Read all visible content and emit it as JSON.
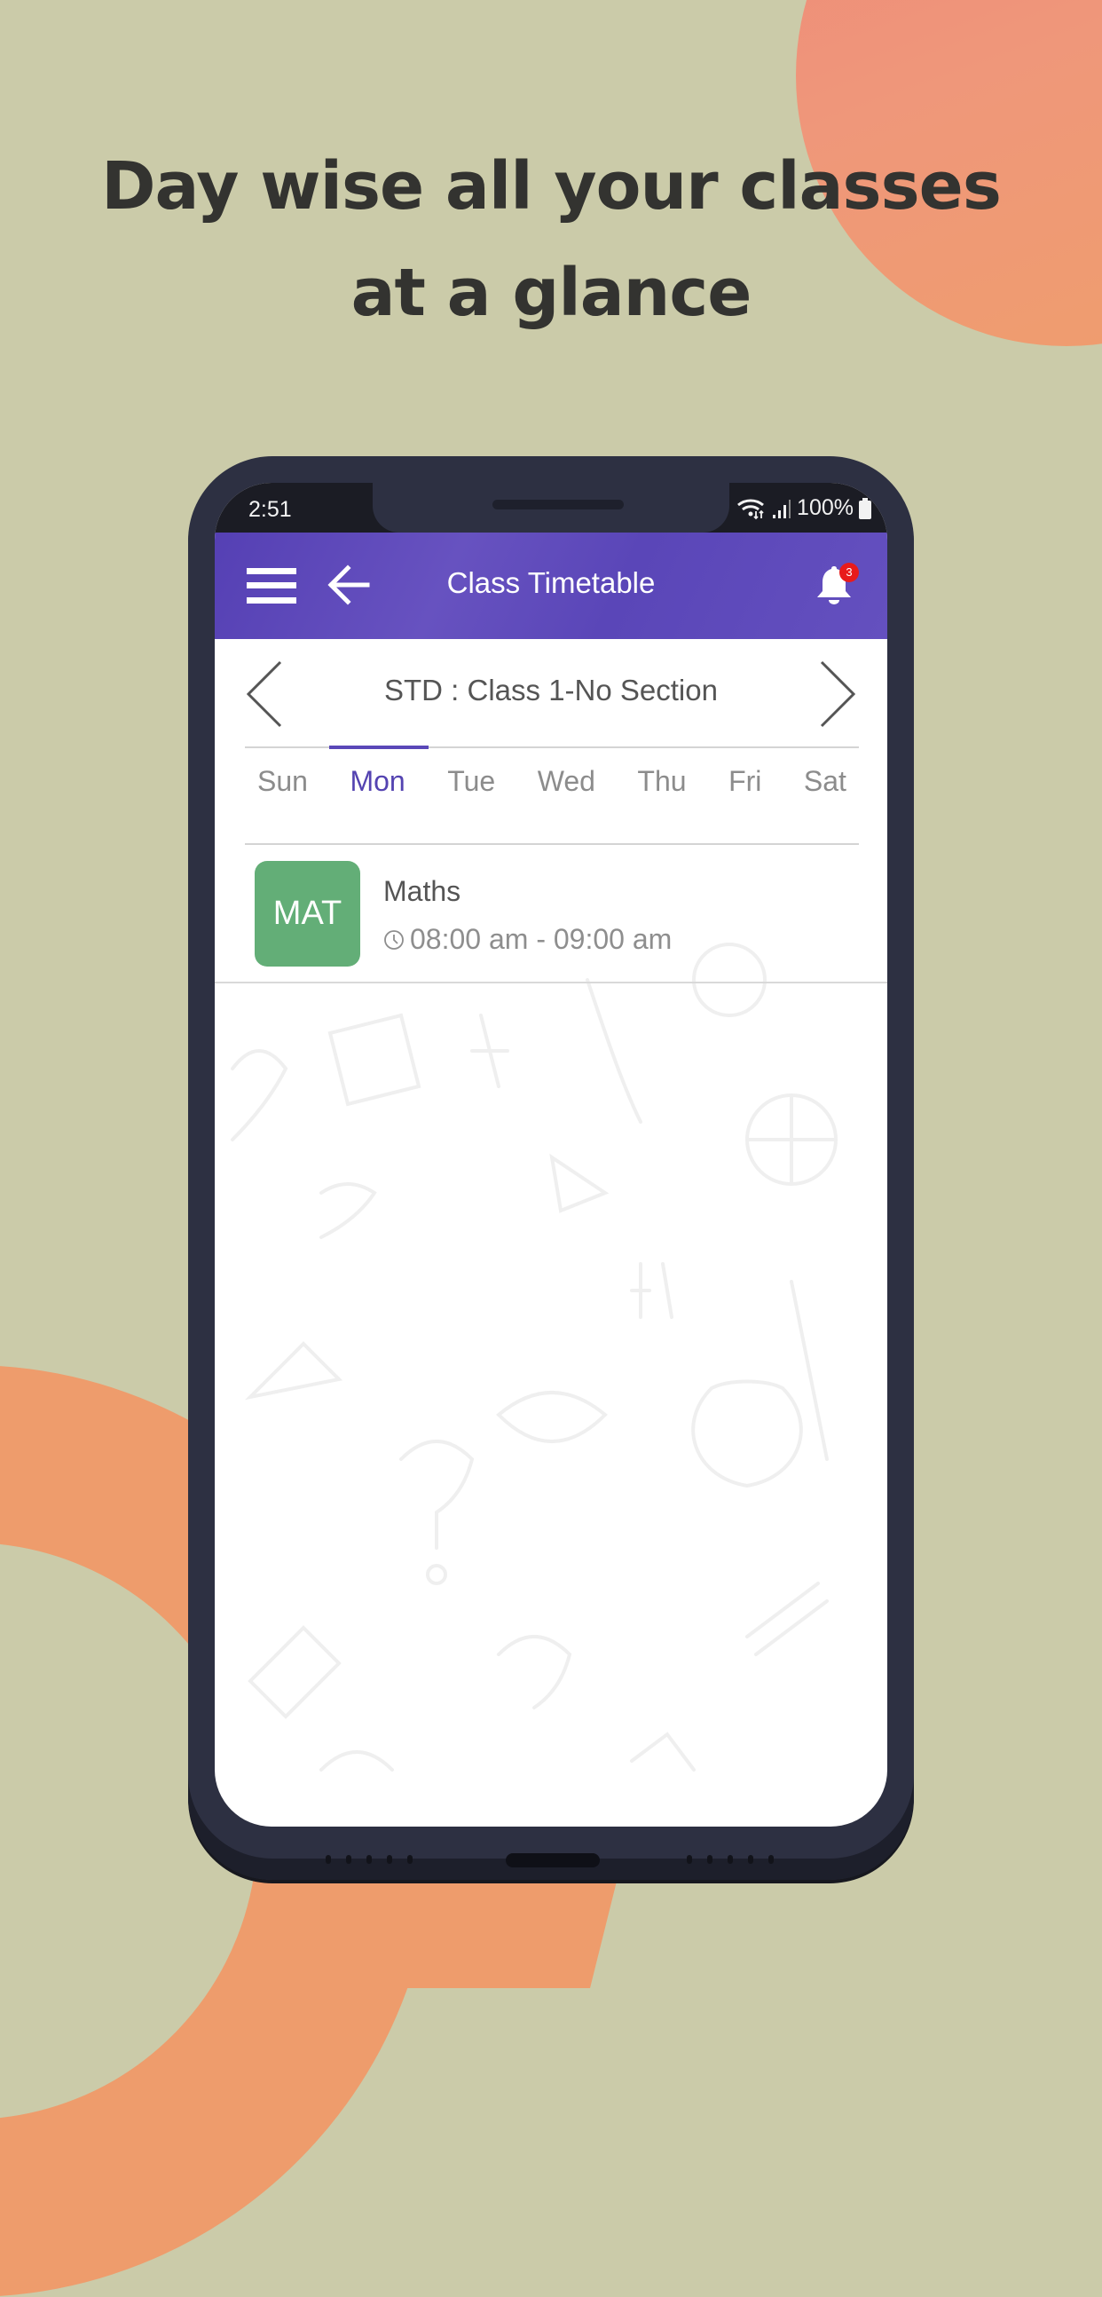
{
  "headline": {
    "line1": "Day wise all your classes",
    "line2": "at a glance"
  },
  "colors": {
    "background": "#cbcba9",
    "accent_orange": "#ee9c6c",
    "app_bar": "#5a46b8",
    "active_tab": "#5443b1",
    "subject_badge": "#63ae77",
    "notification_badge": "#e81b1b"
  },
  "status_bar": {
    "time": "2:51",
    "battery": "100%",
    "icons": [
      "wifi-icon",
      "signal-icon",
      "battery-icon"
    ]
  },
  "app_bar": {
    "title": "Class Timetable",
    "menu_icon": "hamburger-menu-icon",
    "back_icon": "arrow-left-icon",
    "notification_icon": "bell-icon",
    "notification_count": "3"
  },
  "class_selector": {
    "label": "STD : Class 1-No Section",
    "prev_icon": "chevron-left-icon",
    "next_icon": "chevron-right-icon"
  },
  "day_tabs": {
    "items": [
      {
        "label": "Sun",
        "active": false
      },
      {
        "label": "Mon",
        "active": true
      },
      {
        "label": "Tue",
        "active": false
      },
      {
        "label": "Wed",
        "active": false
      },
      {
        "label": "Thu",
        "active": false
      },
      {
        "label": "Fri",
        "active": false
      },
      {
        "label": "Sat",
        "active": false
      }
    ]
  },
  "timetable": {
    "entries": [
      {
        "code": "MAT",
        "subject": "Maths",
        "time": "08:00 am - 09:00 am",
        "time_icon": "clock-icon"
      }
    ]
  }
}
